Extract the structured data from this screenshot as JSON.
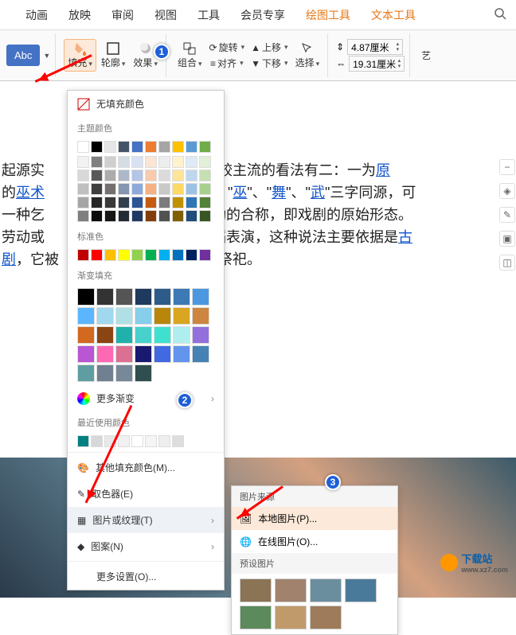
{
  "tabs": {
    "t1": "动画",
    "t2": "放映",
    "t3": "审阅",
    "t4": "视图",
    "t5": "工具",
    "t6": "会员专享",
    "t7": "绘图工具",
    "t8": "文本工具"
  },
  "ribbon": {
    "abc": "Abc",
    "fill": "填充",
    "outline": "轮廓",
    "effect": "效果",
    "group": "组合",
    "rotate": "旋转",
    "align": "对齐",
    "up": "上移",
    "down": "下移",
    "select": "选择",
    "w": "4.87厘米",
    "h": "19.31厘米",
    "art": "艺"
  },
  "doc": {
    "l1a": "起源实",
    "l1b": "比较主流的看法有二：一为",
    "l1c": "原",
    "l2a": "的",
    "l2b": "巫术",
    "l2c": "\"",
    "l2d": "巫",
    "l2e": "\"、\"",
    "l2f": "舞",
    "l2g": "\"、\"",
    "l2h": "武",
    "l2i": "\"三字同源，可",
    "l3a": "一种乞",
    "l3b": "动的合称，即戏剧的原始形态。",
    "l4a": "劳动或",
    "l4b": "蹈表演，这种说法主要依据是",
    "l4c": "古",
    "l5a": "剧",
    "l5b": "，它被",
    "l5c": "祭祀。"
  },
  "dd": {
    "nofill": "无填充颜色",
    "theme": "主题颜色",
    "standard": "标准色",
    "gradient": "渐变填充",
    "moregrad": "更多渐变",
    "recent": "最近使用颜色",
    "morefill": "其他填充颜色(M)...",
    "picker": "取色器(E)",
    "pictex": "图片或纹理(T)",
    "pattern": "图案(N)",
    "moreset": "更多设置(O)..."
  },
  "fly": {
    "src": "图片来源",
    "local": "本地图片(P)...",
    "online": "在线图片(O)...",
    "preset": "预设图片"
  },
  "wm": {
    "text": "下载站",
    "url": "www.xz7.com"
  },
  "themeColors": [
    "#ffffff",
    "#000000",
    "#e7e6e6",
    "#44546a",
    "#4472c4",
    "#ed7d31",
    "#a5a5a5",
    "#ffc000",
    "#5b9bd5",
    "#70ad47"
  ],
  "themeShades": [
    [
      "#f2f2f2",
      "#7f7f7f",
      "#d0cece",
      "#d6dce4",
      "#d9e2f3",
      "#fbe5d5",
      "#ededed",
      "#fff2cc",
      "#deebf6",
      "#e2efd9"
    ],
    [
      "#d8d8d8",
      "#595959",
      "#aeabab",
      "#adb9ca",
      "#b4c6e7",
      "#f7cbac",
      "#dbdbdb",
      "#fee599",
      "#bdd7ee",
      "#c5e0b3"
    ],
    [
      "#bfbfbf",
      "#3f3f3f",
      "#757070",
      "#8496b0",
      "#8eaadb",
      "#f4b183",
      "#c9c9c9",
      "#ffd965",
      "#9cc3e5",
      "#a8d08d"
    ],
    [
      "#a5a5a5",
      "#262626",
      "#3a3838",
      "#323f4f",
      "#2f5496",
      "#c55a11",
      "#7b7b7b",
      "#bf9000",
      "#2e75b5",
      "#538135"
    ],
    [
      "#7f7f7f",
      "#0c0c0c",
      "#171616",
      "#222a35",
      "#1f3864",
      "#833c0b",
      "#525252",
      "#7f6000",
      "#1e4e79",
      "#375623"
    ]
  ],
  "standardColors": [
    "#c00000",
    "#ff0000",
    "#ffc000",
    "#ffff00",
    "#92d050",
    "#00b050",
    "#00b0f0",
    "#0070c0",
    "#002060",
    "#7030a0"
  ],
  "gradients": [
    [
      "#000000",
      "#333333",
      "#555555",
      "#1f3a5f",
      "#2e5c8a",
      "#3d7ab5",
      "#4c98e0",
      "#5bb6ff"
    ],
    [
      "#a0d8ef",
      "#b0e0e6",
      "#87ceeb",
      "#b8860b",
      "#daa520",
      "#cd853f",
      "#d2691e",
      "#8b4513"
    ],
    [
      "#20b2aa",
      "#48d1cc",
      "#40e0d0",
      "#afeeee",
      "#9370db",
      "#ba55d3",
      "#ff69b4",
      "#db7093"
    ],
    [
      "#191970",
      "#4169e1",
      "#6495ed",
      "#4682b4",
      "#5f9ea0",
      "#708090",
      "#778899",
      "#2f4f4f"
    ]
  ],
  "recentColors": [
    "#008080",
    "#d8d8d8",
    "#e8e8e8",
    "#f0f0f0",
    "#ffffff",
    "#f5f5f5",
    "#eeeeee",
    "#dddddd"
  ],
  "textures": [
    "#8b7355",
    "#a0826d",
    "#6b8e9f",
    "#4a7a9a",
    "#5c8a5c",
    "#c19a6b",
    "#9e7b5a"
  ]
}
